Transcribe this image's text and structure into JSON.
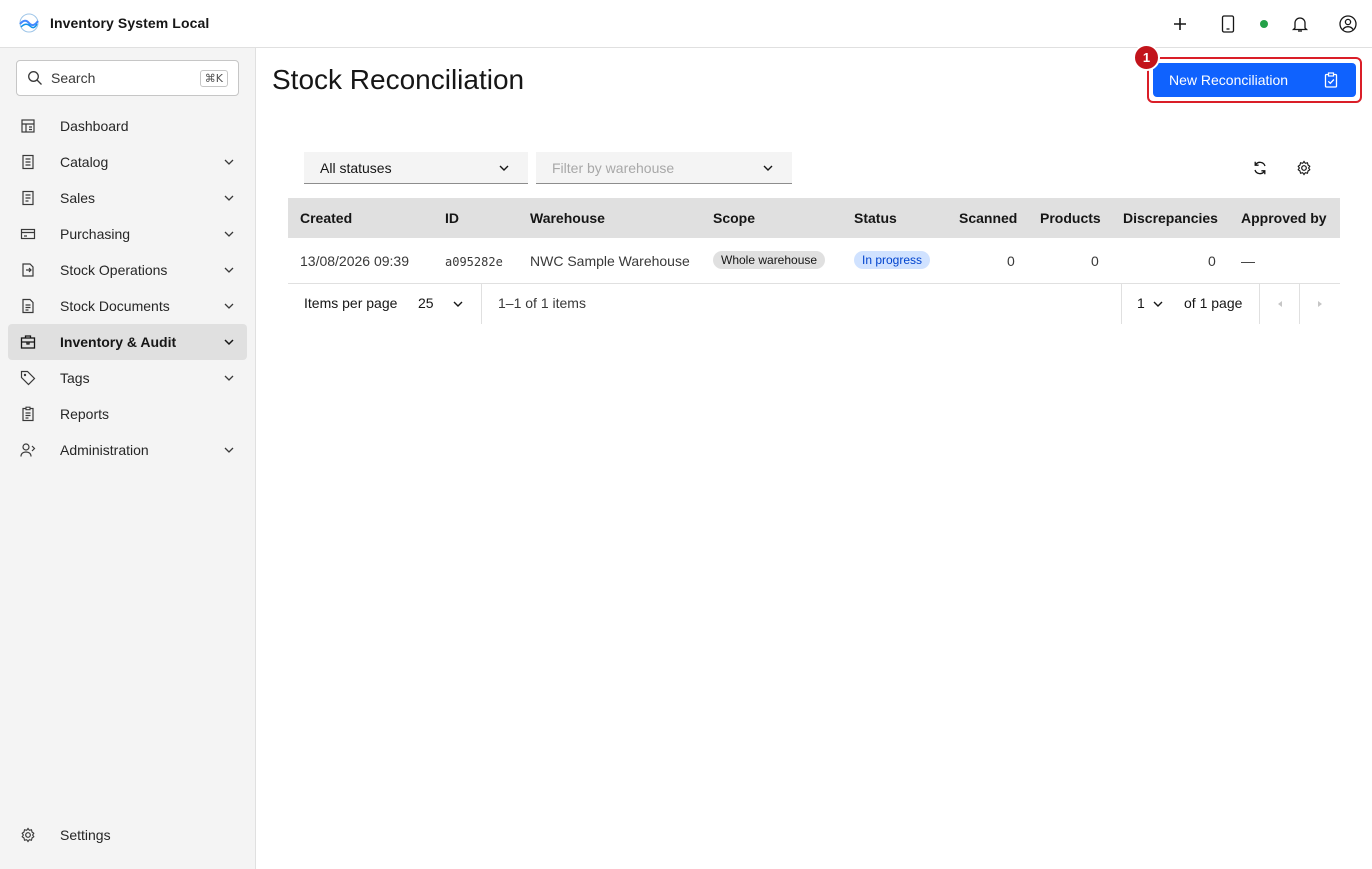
{
  "header": {
    "app_name": "Inventory System Local",
    "status_color": "#24a148",
    "icons": [
      "add-icon",
      "tablet-icon",
      "status-dot",
      "notification-icon",
      "user-avatar-icon"
    ]
  },
  "sidebar": {
    "search_label": "Search",
    "search_shortcut": "⌘K",
    "items": [
      {
        "label": "Dashboard",
        "icon": "dashboard-icon",
        "expandable": false,
        "active": false
      },
      {
        "label": "Catalog",
        "icon": "catalog-icon",
        "expandable": true,
        "active": false
      },
      {
        "label": "Sales",
        "icon": "sales-icon",
        "expandable": true,
        "active": false
      },
      {
        "label": "Purchasing",
        "icon": "purchasing-icon",
        "expandable": true,
        "active": false
      },
      {
        "label": "Stock Operations",
        "icon": "stock-operations-icon",
        "expandable": true,
        "active": false
      },
      {
        "label": "Stock Documents",
        "icon": "stock-documents-icon",
        "expandable": true,
        "active": false
      },
      {
        "label": "Inventory & Audit",
        "icon": "inventory-audit-icon",
        "expandable": true,
        "active": true
      },
      {
        "label": "Tags",
        "icon": "tag-icon",
        "expandable": true,
        "active": false
      },
      {
        "label": "Reports",
        "icon": "reports-icon",
        "expandable": false,
        "active": false
      },
      {
        "label": "Administration",
        "icon": "administration-icon",
        "expandable": true,
        "active": false
      }
    ],
    "settings_label": "Settings"
  },
  "main": {
    "title": "Stock Reconciliation",
    "new_button_label": "New Reconciliation",
    "annotation_badge": "1",
    "filters": {
      "status_value": "All statuses",
      "warehouse_placeholder": "Filter by warehouse"
    },
    "table": {
      "columns": [
        "Created",
        "ID",
        "Warehouse",
        "Scope",
        "Status",
        "Scanned",
        "Products",
        "Discrepancies",
        "Approved by"
      ],
      "rows": [
        {
          "created": "13/08/2026 09:39",
          "id": "a095282e",
          "warehouse": "NWC Sample Warehouse",
          "scope": "Whole warehouse",
          "status": "In progress",
          "scanned": "0",
          "products": "0",
          "discrepancies": "0",
          "approved_by": "—"
        }
      ]
    },
    "pagination": {
      "items_per_page_label": "Items per page",
      "items_per_page": "25",
      "range_text": "1–1 of 1 items",
      "current_page": "1",
      "total_pages_text": "of 1 page"
    }
  },
  "colors": {
    "primary": "#0f62fe",
    "highlight_border": "#da1e28",
    "status_tag_bg": "#d0e2ff",
    "status_tag_text": "#0043ce"
  }
}
